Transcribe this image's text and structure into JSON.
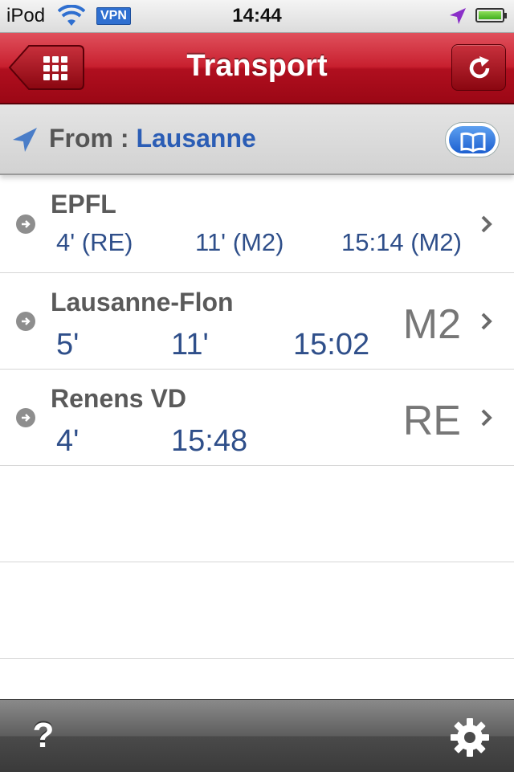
{
  "status_bar": {
    "carrier": "iPod",
    "vpn": "VPN",
    "time": "14:44",
    "battery_level": 1.0
  },
  "nav": {
    "title": "Transport",
    "back_icon": "grid-icon",
    "refresh_icon": "refresh-icon"
  },
  "from": {
    "label": "From : ",
    "value": "Lausanne",
    "bookmark_icon": "book-icon"
  },
  "destinations": [
    {
      "name": "EPFL",
      "times": [
        "4' (RE)",
        "11' (M2)",
        "15:14 (M2)"
      ],
      "line": ""
    },
    {
      "name": "Lausanne-Flon",
      "times": [
        "5'",
        "11'",
        "15:02"
      ],
      "line": "M2"
    },
    {
      "name": "Renens VD",
      "times": [
        "4'",
        "15:48"
      ],
      "line": "RE"
    }
  ],
  "toolbar": {
    "help_label": "?",
    "settings_icon": "gear-icon"
  },
  "colors": {
    "nav_red": "#b00f1f",
    "time_blue": "#2f4f8a",
    "from_blue": "#2b5db5"
  }
}
